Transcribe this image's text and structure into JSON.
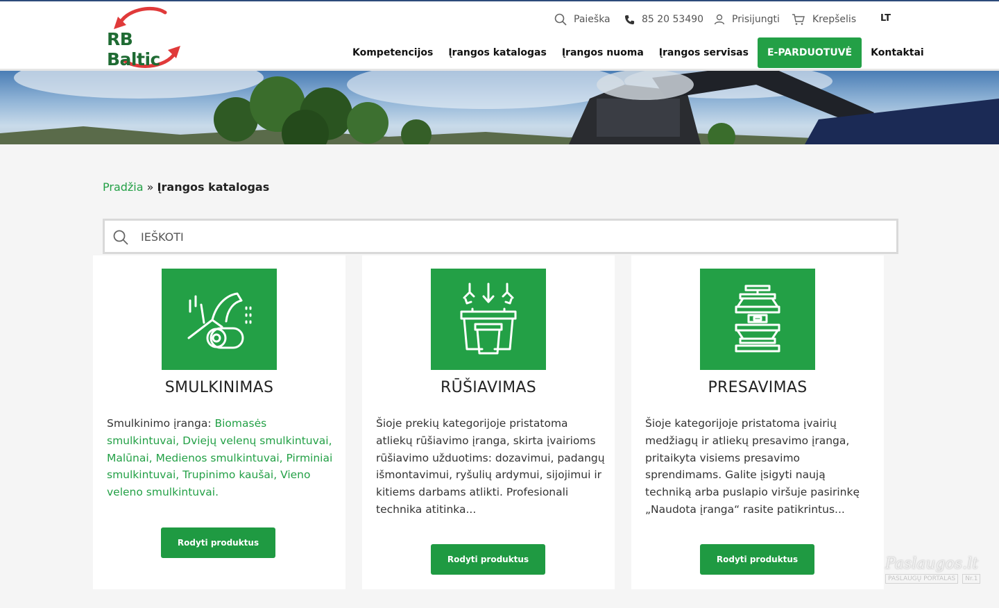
{
  "header": {
    "logo_text": "RB Baltic",
    "search_label": "Paieška",
    "phone": "85 20 53490",
    "login_label": "Prisijungti",
    "cart_label": "Krepšelis",
    "language": "LT"
  },
  "nav": {
    "items": [
      {
        "label": "Kompetencijos"
      },
      {
        "label": "Įrangos katalogas"
      },
      {
        "label": "Įrangos nuoma"
      },
      {
        "label": "Įrangos servisas"
      },
      {
        "label": "E-PARDUOTUVĖ"
      },
      {
        "label": "Kontaktai"
      }
    ]
  },
  "breadcrumb": {
    "home": "Pradžia",
    "separator": "»",
    "current": "Įrangos katalogas"
  },
  "search": {
    "placeholder": "IEŠKOTI"
  },
  "cards": [
    {
      "title": "SMULKINIMAS",
      "icon": "shredder-icon",
      "desc_prefix": "Smulkinimo įranga: ",
      "desc_links": "Biomasės smulkintuvai, Dviejų velenų smulkintuvai, Malūnai, Medienos smulkintuvai, Pirminiai smulkintuvai, Trupinimo kaušai, Vieno veleno smulkintuvai.",
      "button": "Rodyti produktus"
    },
    {
      "title": "RŪŠIAVIMAS",
      "icon": "sorting-bins-icon",
      "desc": "Šioje prekių kategorijoje pristatoma atliekų rūšiavimo įranga, skirta įvairioms rūšiavimo užduotims: dozavimui, padangų išmontavimui, ryšulių ardymui, sijojimui ir kitiems darbams atlikti. Profesionali technika atitinka...",
      "button": "Rodyti produktus"
    },
    {
      "title": "PRESAVIMAS",
      "icon": "press-icon",
      "desc": "Šioje kategorijoje pristatoma įvairių medžiagų ir atliekų presavimo įranga, pritaikyta visiems presavimo sprendimams. Galite įsigyti naują techniką arba puslapio viršuje pasirinkę „Naudota įranga“ rasite patikrintus...",
      "button": "Rodyti produktus"
    }
  ],
  "watermark": {
    "brand": "Paslaugos.lt",
    "tagline": "PASLAUGŲ PORTALAS",
    "rank": "Nr.1"
  },
  "colors": {
    "accent_green": "#23a046",
    "logo_red": "#e03a3a",
    "logo_green": "#1f6b33"
  }
}
